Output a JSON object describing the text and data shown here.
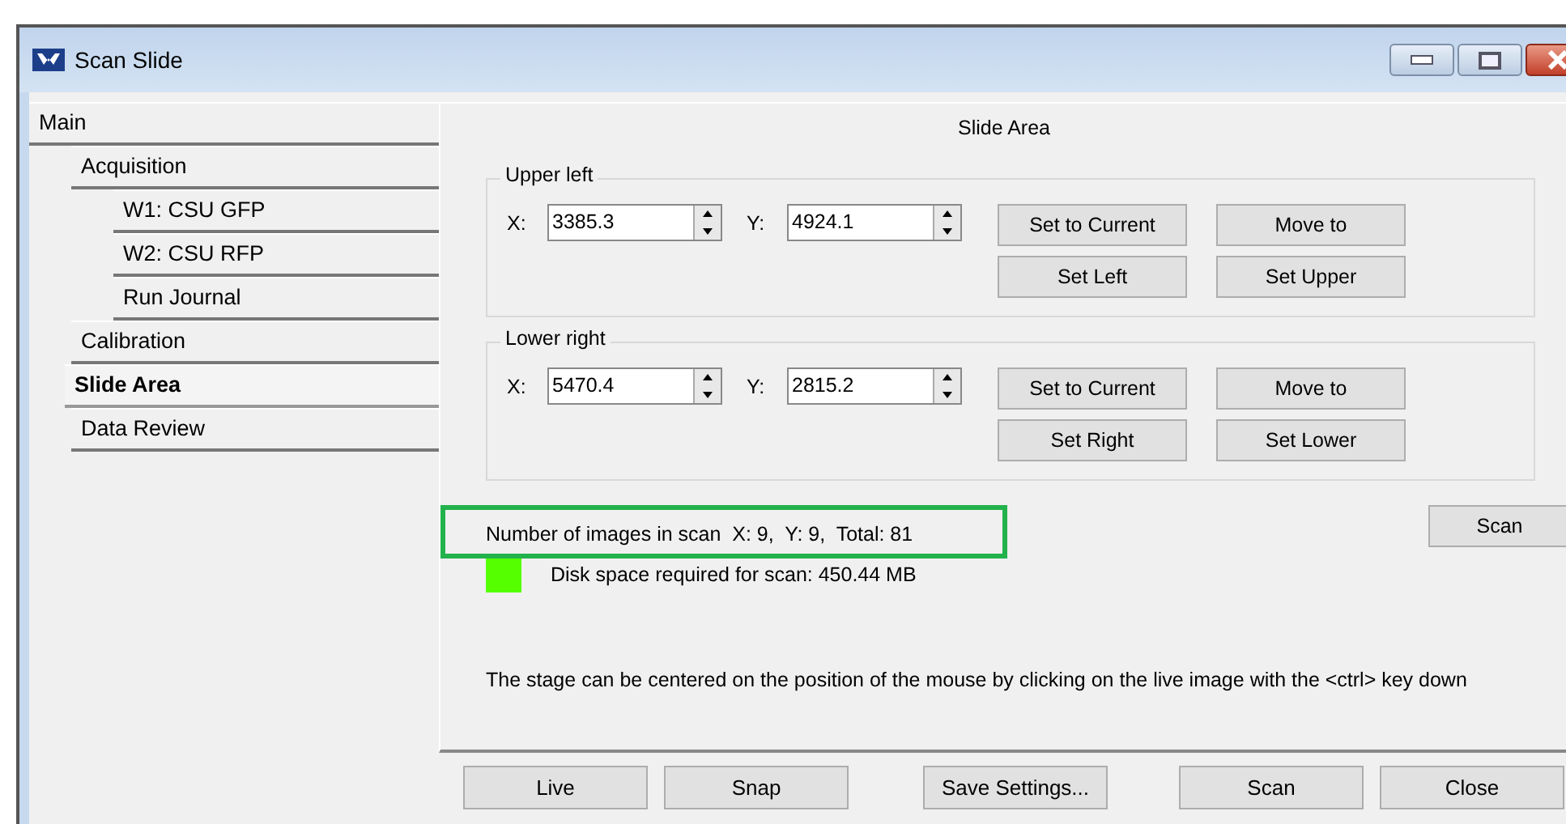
{
  "window": {
    "title": "Scan Slide"
  },
  "nav": [
    {
      "label": "Main",
      "selected": false,
      "children": [
        {
          "label": "Acquisition",
          "selected": false,
          "children": [
            {
              "label": "W1: CSU GFP",
              "selected": false
            },
            {
              "label": "W2: CSU RFP",
              "selected": false
            },
            {
              "label": "Run Journal",
              "selected": false
            }
          ]
        },
        {
          "label": "Calibration",
          "selected": false
        },
        {
          "label": "Slide Area",
          "selected": true
        },
        {
          "label": "Data Review",
          "selected": false
        }
      ]
    }
  ],
  "panel_title": "Slide Area",
  "groups": [
    {
      "title": "Upper left",
      "x_label": "X:",
      "x_value": "3385.3",
      "y_label": "Y:",
      "y_value": "4924.1",
      "buttons": [
        "Set to Current",
        "Move to",
        "Set Left",
        "Set Upper"
      ]
    },
    {
      "title": "Lower right",
      "x_label": "X:",
      "x_value": "5470.4",
      "y_label": "Y:",
      "y_value": "2815.2",
      "buttons": [
        "Set to Current",
        "Move to",
        "Set Right",
        "Set Lower"
      ]
    }
  ],
  "image_count": "Number of images in scan  X: 9,  Y: 9,  Total: 81",
  "scan_button": "Scan",
  "disk_status": {
    "color": "#55ff00",
    "text": "Disk space required for scan: 450.44 MB"
  },
  "hint": "The stage can be centered on the position of the mouse by clicking on the live image with the <ctrl> key down",
  "footer_buttons": [
    {
      "label": "Live",
      "kind": "left"
    },
    {
      "label": "Snap",
      "kind": "left"
    },
    {
      "label": "Save Settings...",
      "kind": "middle"
    },
    {
      "label": "Scan",
      "kind": "right"
    },
    {
      "label": "Close",
      "kind": "right"
    }
  ]
}
